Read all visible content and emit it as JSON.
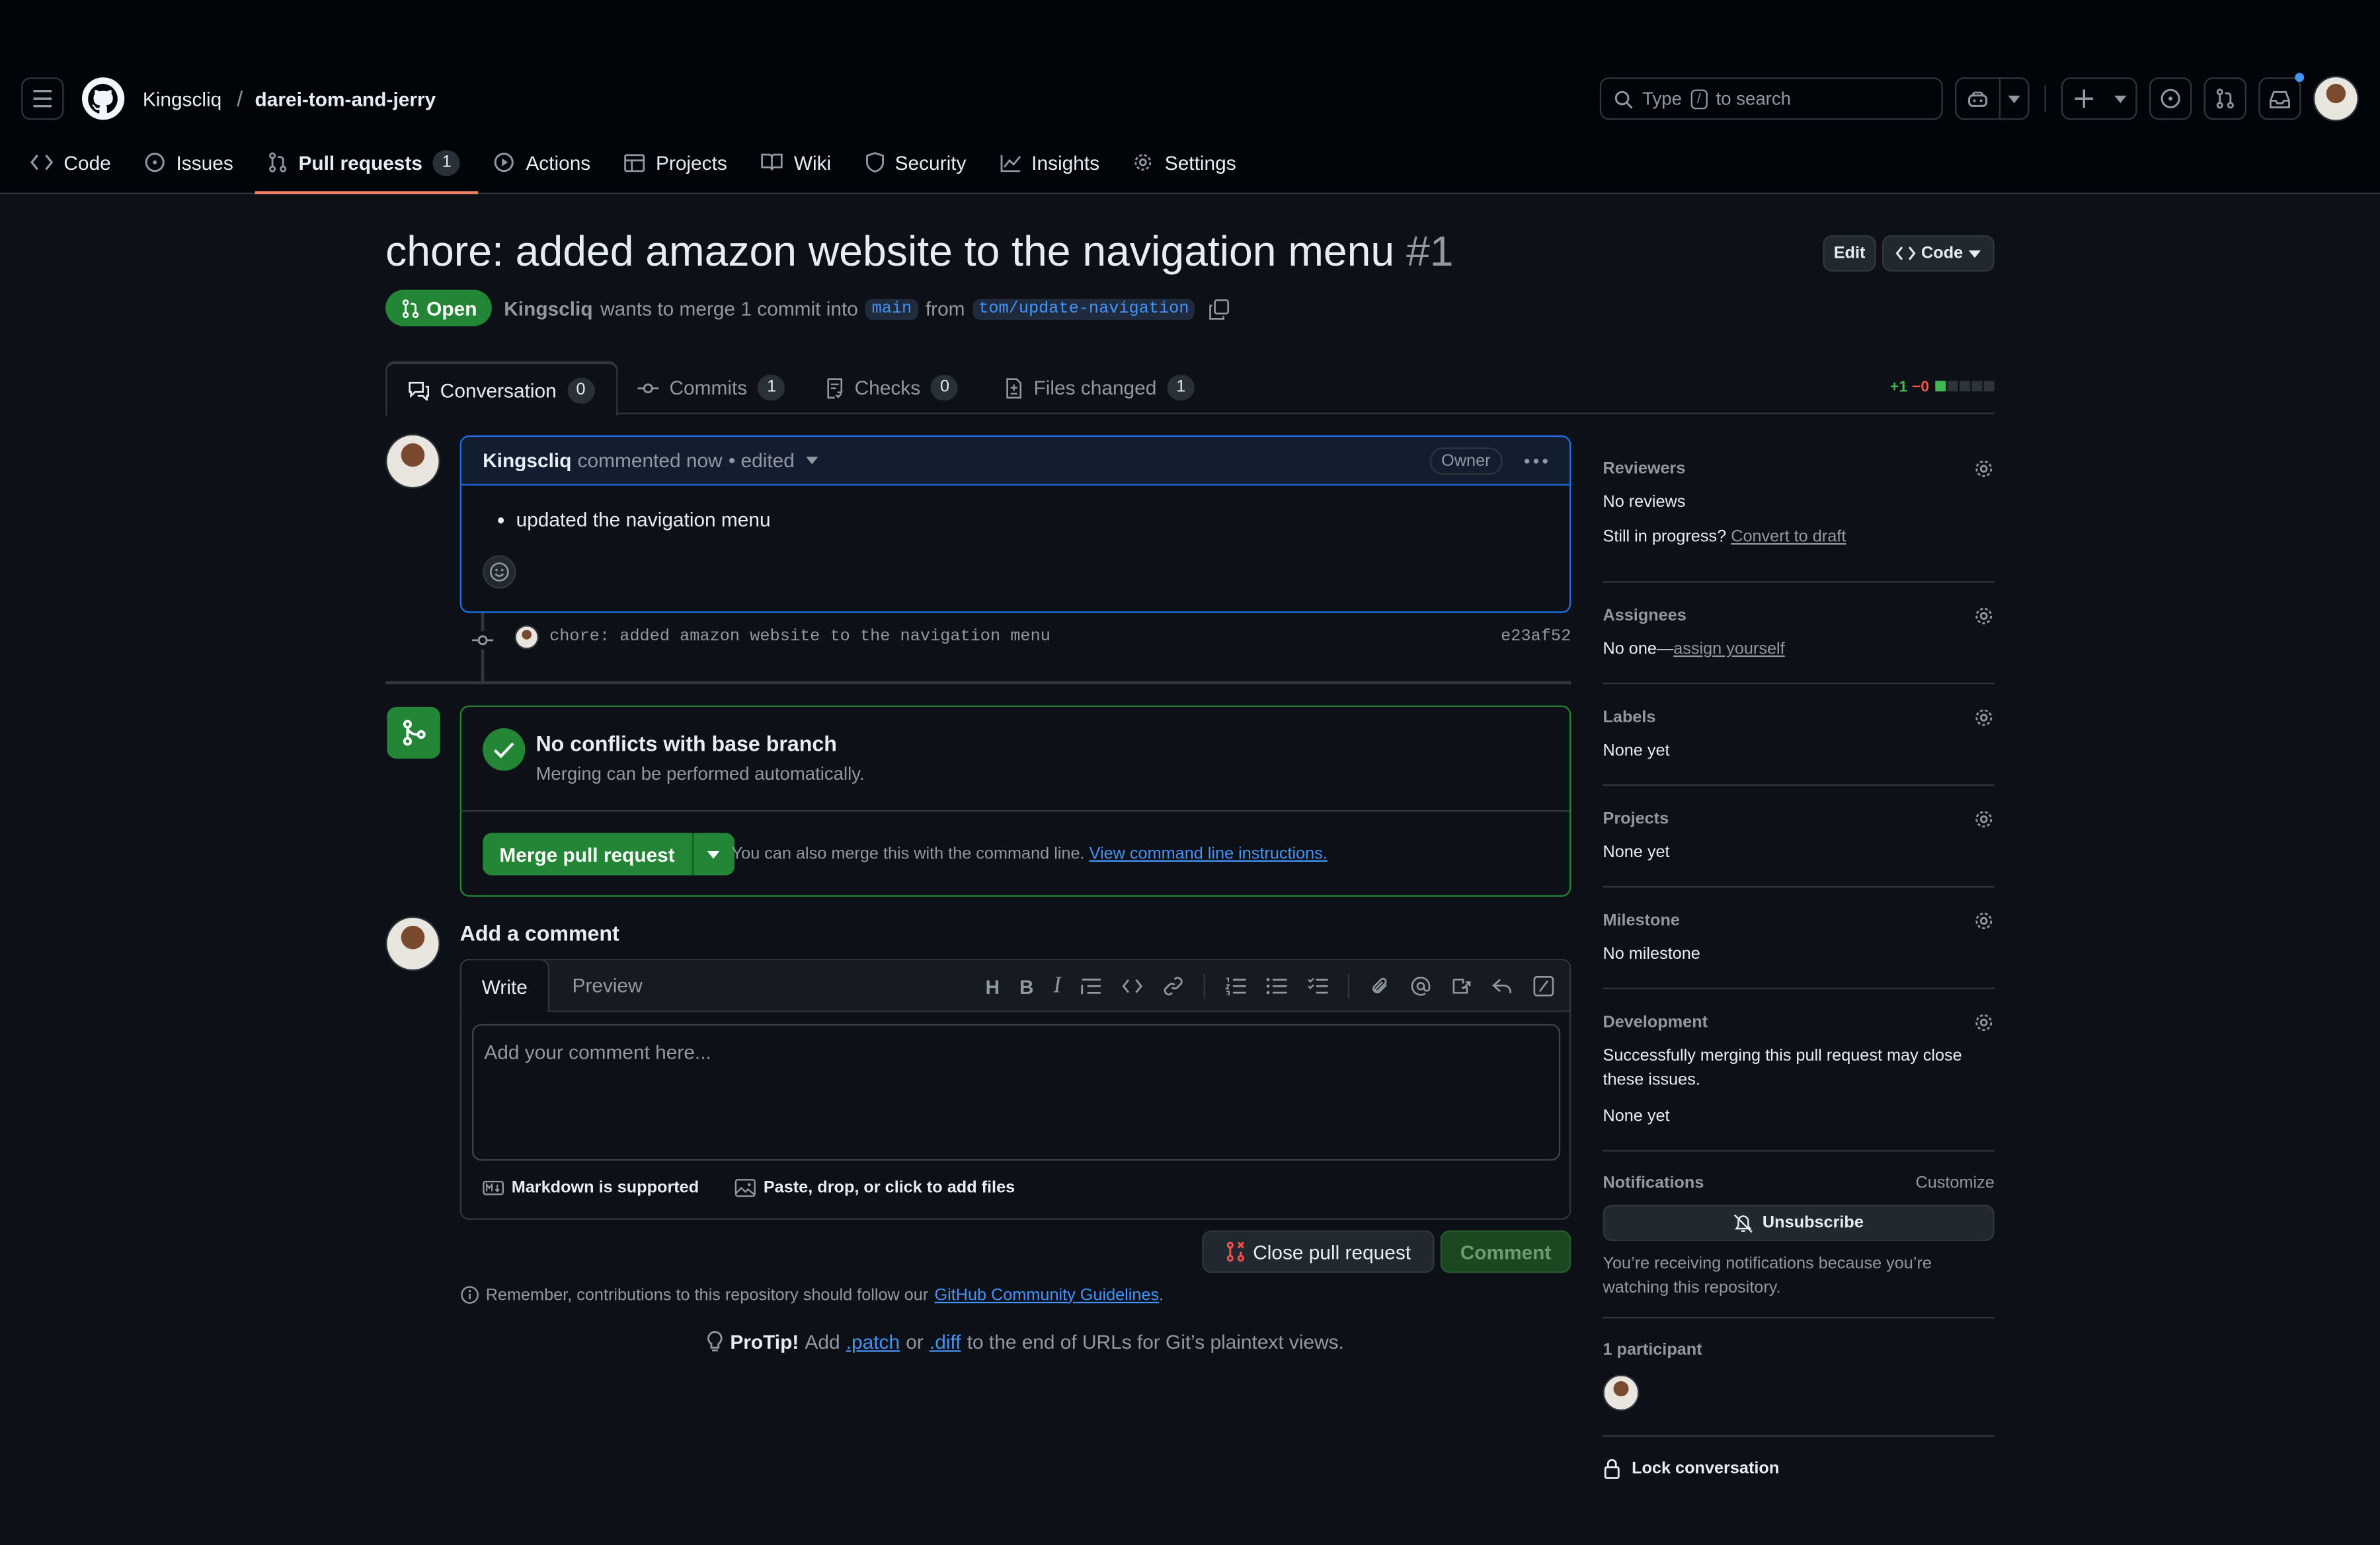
{
  "header": {
    "owner": "Kingscliq",
    "separator": "/",
    "repo": "darei-tom-and-jerry",
    "search_text_before": "Type",
    "search_key": "/",
    "search_text_after": "to search"
  },
  "repo_tabs": [
    {
      "label": "Code",
      "icon": "code-icon"
    },
    {
      "label": "Issues",
      "icon": "issue-icon"
    },
    {
      "label": "Pull requests",
      "icon": "pull-request-icon",
      "count": "1"
    },
    {
      "label": "Actions",
      "icon": "play-icon"
    },
    {
      "label": "Projects",
      "icon": "table-icon"
    },
    {
      "label": "Wiki",
      "icon": "book-icon"
    },
    {
      "label": "Security",
      "icon": "shield-icon"
    },
    {
      "label": "Insights",
      "icon": "graph-icon"
    },
    {
      "label": "Settings",
      "icon": "gear-icon"
    }
  ],
  "pr": {
    "title": "chore: added amazon website to the navigation menu",
    "number": "#1",
    "edit_label": "Edit",
    "code_label": "Code",
    "state": "Open",
    "author": "Kingscliq",
    "merge_text": "wants to merge 1 commit into",
    "base_branch": "main",
    "from_text": "from",
    "head_branch": "tom/update-navigation"
  },
  "pr_tabs": {
    "conversation": {
      "label": "Conversation",
      "count": "0"
    },
    "commits": {
      "label": "Commits",
      "count": "1"
    },
    "checks": {
      "label": "Checks",
      "count": "0"
    },
    "files": {
      "label": "Files changed",
      "count": "1"
    },
    "additions": "+1",
    "deletions": "−0"
  },
  "comment": {
    "author": "Kingscliq",
    "meta": "commented now",
    "edited": "• edited",
    "badge": "Owner",
    "body": "updated the navigation menu"
  },
  "commit": {
    "message": "chore: added amazon website to the navigation menu",
    "sha": "e23af52"
  },
  "merge": {
    "title": "No conflicts with base branch",
    "subtitle": "Merging can be performed automatically.",
    "button": "Merge pull request",
    "note": "You can also merge this with the command line.",
    "link": "View command line instructions."
  },
  "new_comment": {
    "heading": "Add a comment",
    "tab_write": "Write",
    "tab_preview": "Preview",
    "placeholder": "Add your comment here...",
    "markdown": "Markdown is supported",
    "files": "Paste, drop, or click to add files",
    "close_button": "Close pull request",
    "comment_button": "Comment",
    "guidelines_text": "Remember, contributions to this repository should follow our",
    "guidelines_link": "GitHub Community Guidelines",
    "guidelines_end": "."
  },
  "protip": {
    "label": "ProTip!",
    "text1": "Add",
    "patch": ".patch",
    "text2": "or",
    "diff": ".diff",
    "text3": "to the end of URLs for Git’s plaintext views."
  },
  "sidebar": {
    "reviewers": {
      "title": "Reviewers",
      "value": "No reviews",
      "extra": "Still in progress?",
      "link": "Convert to draft"
    },
    "assignees": {
      "title": "Assignees",
      "value": "No one—",
      "link": "assign yourself"
    },
    "labels": {
      "title": "Labels",
      "value": "None yet"
    },
    "projects": {
      "title": "Projects",
      "value": "None yet"
    },
    "milestone": {
      "title": "Milestone",
      "value": "No milestone"
    },
    "development": {
      "title": "Development",
      "value": "Successfully merging this pull request may close these issues.",
      "extra": "None yet"
    },
    "notifications": {
      "title": "Notifications",
      "customize": "Customize",
      "button": "Unsubscribe",
      "note": "You’re receiving notifications because you’re watching this repository."
    },
    "participants": {
      "title": "1 participant"
    },
    "lock": "Lock conversation"
  },
  "colors": {
    "accent": "#4493f8",
    "success": "#238636",
    "tab_underline": "#f78166",
    "danger": "#f85149"
  }
}
